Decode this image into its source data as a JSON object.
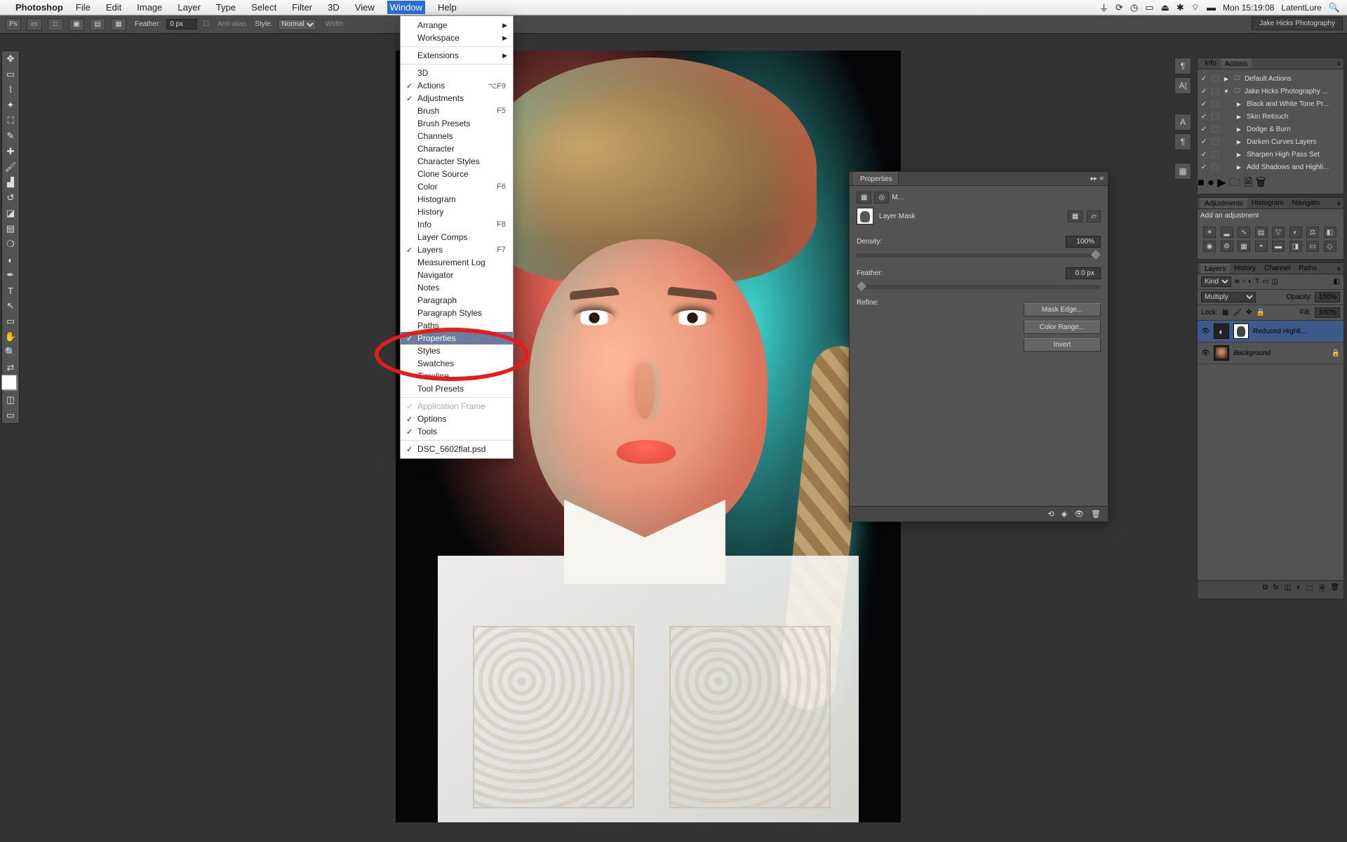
{
  "menubar": {
    "apple": "",
    "app": "Photoshop",
    "items": [
      "File",
      "Edit",
      "Image",
      "Layer",
      "Type",
      "Select",
      "Filter",
      "3D",
      "View",
      "Window",
      "Help"
    ],
    "open_item": "Window",
    "right": {
      "clock": "Mon 15:19:08",
      "user": "LatentLure"
    }
  },
  "option_bar": {
    "feather_label": "Feather:",
    "feather_value": "0 px",
    "antialias": "Anti-alias",
    "style_label": "Style:",
    "style_value": "Normal",
    "width_label": "Width:"
  },
  "doc_tab": "Jake Hicks Photography",
  "dropdown": {
    "items": [
      {
        "label": "Arrange",
        "sub": true
      },
      {
        "label": "Workspace",
        "sub": true
      },
      {
        "sep": true
      },
      {
        "label": "Extensions",
        "sub": true
      },
      {
        "sep": true
      },
      {
        "label": "3D"
      },
      {
        "label": "Actions",
        "check": true,
        "shortcut": "⌥F9"
      },
      {
        "label": "Adjustments",
        "check": true
      },
      {
        "label": "Brush",
        "shortcut": "F5"
      },
      {
        "label": "Brush Presets"
      },
      {
        "label": "Channels"
      },
      {
        "label": "Character"
      },
      {
        "label": "Character Styles"
      },
      {
        "label": "Clone Source"
      },
      {
        "label": "Color",
        "shortcut": "F6"
      },
      {
        "label": "Histogram"
      },
      {
        "label": "History"
      },
      {
        "label": "Info",
        "shortcut": "F8"
      },
      {
        "label": "Layer Comps"
      },
      {
        "label": "Layers",
        "check": true,
        "shortcut": "F7"
      },
      {
        "label": "Measurement Log"
      },
      {
        "label": "Navigator"
      },
      {
        "label": "Notes"
      },
      {
        "label": "Paragraph"
      },
      {
        "label": "Paragraph Styles"
      },
      {
        "label": "Paths"
      },
      {
        "label": "Properties",
        "check": true,
        "highlight": true
      },
      {
        "label": "Styles"
      },
      {
        "label": "Swatches"
      },
      {
        "label": "Timeline"
      },
      {
        "label": "Tool Presets"
      },
      {
        "sep": true
      },
      {
        "label": "Application Frame",
        "check": true,
        "disabled": true
      },
      {
        "label": "Options",
        "check": true
      },
      {
        "label": "Tools",
        "check": true
      },
      {
        "sep": true
      },
      {
        "label": "DSC_5602flat.psd",
        "check": true
      }
    ]
  },
  "properties": {
    "title": "Properties",
    "mode": "M…",
    "mask_label": "Layer Mask",
    "density_label": "Density:",
    "density_value": "100%",
    "feather_label": "Feather:",
    "feather_value": "0.0 px",
    "refine_label": "Refine:",
    "btn_mask_edge": "Mask Edge...",
    "btn_color_range": "Color Range...",
    "btn_invert": "Invert"
  },
  "right": {
    "info_tab": "Info",
    "actions_tab": "Actions",
    "actions": [
      {
        "label": "Default Actions",
        "folder": true
      },
      {
        "label": "Jake Hicks Photography ...",
        "folder": true,
        "open": true
      },
      {
        "label": "Black and White Tone Pr...",
        "indent": 1
      },
      {
        "label": "Skin Retouch",
        "indent": 1
      },
      {
        "label": "Dodge & Burn",
        "indent": 1
      },
      {
        "label": "Darken Curves Layers",
        "indent": 1
      },
      {
        "label": "Sharpen High Pass Set",
        "indent": 1
      },
      {
        "label": "Add Shadows and Highli...",
        "indent": 1
      }
    ],
    "adjustments_tab": "Adjustments",
    "histogram_tab": "Histogram",
    "navigator_tab": "Navigato",
    "add_adjustment": "Add an adjustment",
    "layers": {
      "tabs": [
        "Layers",
        "History",
        "Channel",
        "Paths"
      ],
      "kind_label": "Kind",
      "blend": "Multiply",
      "opacity_label": "Opacity:",
      "opacity_value": "100%",
      "lock_label": "Lock:",
      "fill_label": "Fill:",
      "fill_value": "100%",
      "items": [
        {
          "name": "Reduced Highli...",
          "adj": true,
          "mask": true,
          "sel": true
        },
        {
          "name": "Background",
          "locked": true
        }
      ]
    }
  }
}
